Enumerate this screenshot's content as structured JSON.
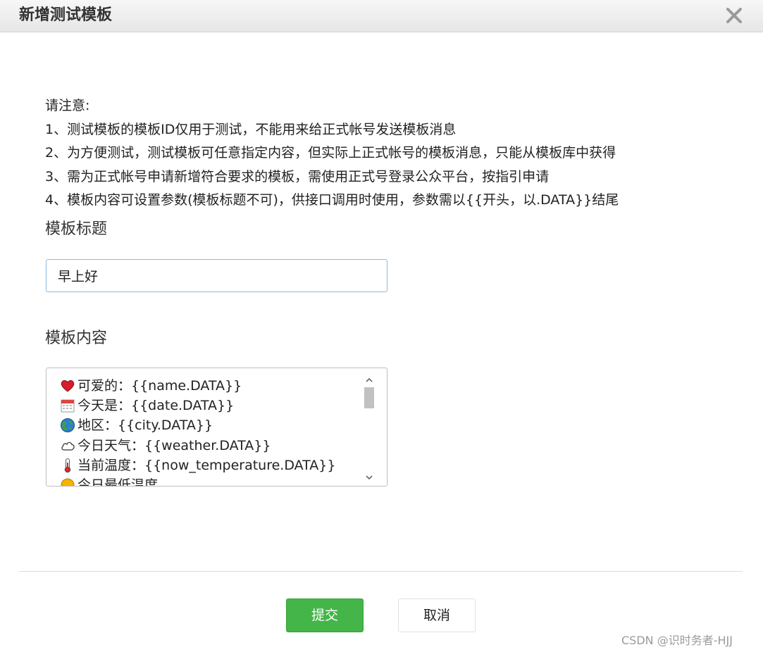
{
  "dialog": {
    "title": "新增测试模板",
    "close_icon": "close-icon"
  },
  "notice": {
    "heading": "请注意:",
    "items": [
      "1、测试模板的模板ID仅用于测试，不能用来给正式帐号发送模板消息",
      "2、为方便测试，测试模板可任意指定内容，但实际上正式帐号的模板消息，只能从模板库中获得",
      "3、需为正式帐号申请新增符合要求的模板，需使用正式号登录公众平台，按指引申请",
      "4、模板内容可设置参数(模板标题不可)，供接口调用时使用，参数需以{{开头，以.DATA}}结尾"
    ]
  },
  "form": {
    "title_label": "模板标题",
    "title_value": "早上好",
    "content_label": "模板内容",
    "content_lines": [
      {
        "icon": "heart-icon",
        "text": "可爱的：{{name.DATA}}"
      },
      {
        "icon": "calendar-icon",
        "text": "今天是：{{date.DATA}}"
      },
      {
        "icon": "globe-icon",
        "text": "地区：{{city.DATA}}"
      },
      {
        "icon": "cloud-icon",
        "text": "今日天气：{{weather.DATA}}"
      },
      {
        "icon": "thermometer-icon",
        "text": "当前温度：{{now_temperature.DATA}}"
      },
      {
        "icon": "sun-icon",
        "text": "今日最低温度"
      }
    ]
  },
  "buttons": {
    "submit": "提交",
    "cancel": "取消"
  },
  "watermark": "CSDN @识时务者-HJJ",
  "colors": {
    "submit_bg": "#44b549",
    "input_border": "#8fb8dc"
  }
}
